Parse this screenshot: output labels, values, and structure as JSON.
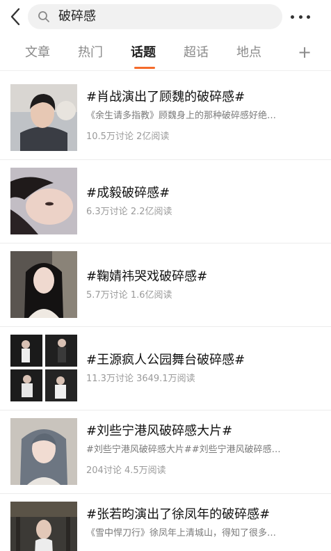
{
  "search": {
    "query": "破碎感"
  },
  "tabs": [
    {
      "label": "文章"
    },
    {
      "label": "热门"
    },
    {
      "label": "话题"
    },
    {
      "label": "超话"
    },
    {
      "label": "地点"
    }
  ],
  "tab_add_label": "+",
  "active_tab": "话题",
  "colors": {
    "accent": "#f56b2a",
    "text_primary": "#111111",
    "text_secondary": "#7a7a7a"
  },
  "topics": [
    {
      "title": "#肖战演出了顾魏的破碎感#",
      "desc": "《余生请多指教》顾魏身上的那种破碎感好绝…",
      "discussions": "10.5万讨论",
      "reads": "2亿阅读"
    },
    {
      "title": "#成毅破碎感#",
      "desc": "",
      "discussions": "6.3万讨论",
      "reads": "2.2亿阅读"
    },
    {
      "title": "#鞠婧祎哭戏破碎感#",
      "desc": "",
      "discussions": "5.7万讨论",
      "reads": "1.6亿阅读"
    },
    {
      "title": "#王源疯人公园舞台破碎感#",
      "desc": "",
      "discussions": "11.3万讨论",
      "reads": "3649.1万阅读"
    },
    {
      "title": "#刘些宁港风破碎感大片#",
      "desc": "#刘些宁港风破碎感大片##刘些宁港风破碎感…",
      "discussions": "204讨论",
      "reads": "4.5万阅读"
    },
    {
      "title": "#张若昀演出了徐凤年的破碎感#",
      "desc": "《雪中悍刀行》徐凤年上清城山，得知了很多…",
      "discussions": "",
      "reads": ""
    }
  ]
}
